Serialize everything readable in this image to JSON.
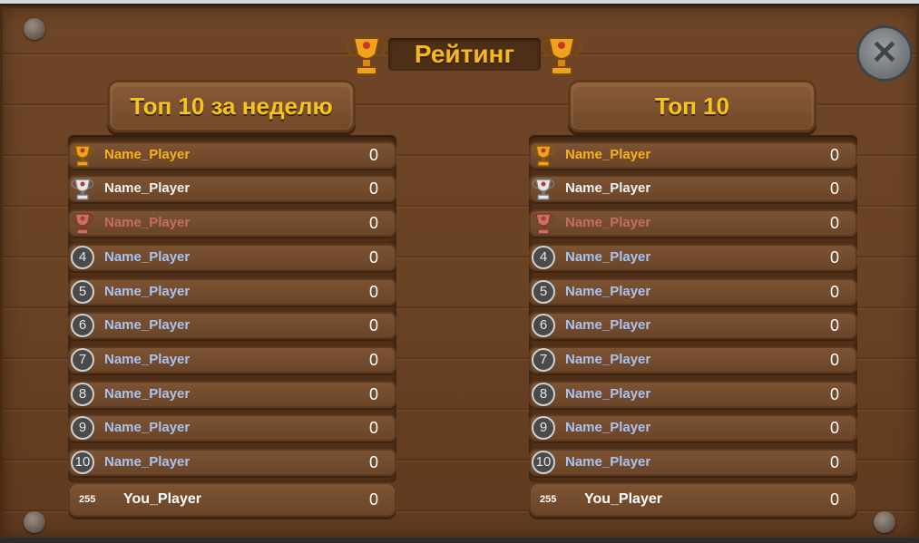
{
  "title": "Рейтинг",
  "close_icon": "close-icon",
  "colors": {
    "gold": "#f7b21a",
    "silver": "#f2f2f2",
    "bronze": "#c46f5c",
    "regular_name": "#a9c3f0"
  },
  "panels": [
    {
      "header": "Топ 10 за неделю",
      "rows": [
        {
          "rank": "1",
          "medal": "gold",
          "name": "Name_Player",
          "score": "0"
        },
        {
          "rank": "2",
          "medal": "silver",
          "name": "Name_Player",
          "score": "0"
        },
        {
          "rank": "3",
          "medal": "bronze",
          "name": "Name_Player",
          "score": "0"
        },
        {
          "rank": "4",
          "medal": "",
          "name": "Name_Player",
          "score": "0"
        },
        {
          "rank": "5",
          "medal": "",
          "name": "Name_Player",
          "score": "0"
        },
        {
          "rank": "6",
          "medal": "",
          "name": "Name_Player",
          "score": "0"
        },
        {
          "rank": "7",
          "medal": "",
          "name": "Name_Player",
          "score": "0"
        },
        {
          "rank": "8",
          "medal": "",
          "name": "Name_Player",
          "score": "0"
        },
        {
          "rank": "9",
          "medal": "",
          "name": "Name_Player",
          "score": "0"
        },
        {
          "rank": "10",
          "medal": "",
          "name": "Name_Player",
          "score": "0"
        }
      ],
      "you": {
        "rank": "255",
        "name": "You_Player",
        "score": "0"
      }
    },
    {
      "header": "Топ 10",
      "rows": [
        {
          "rank": "1",
          "medal": "gold",
          "name": "Name_Player",
          "score": "0"
        },
        {
          "rank": "2",
          "medal": "silver",
          "name": "Name_Player",
          "score": "0"
        },
        {
          "rank": "3",
          "medal": "bronze",
          "name": "Name_Player",
          "score": "0"
        },
        {
          "rank": "4",
          "medal": "",
          "name": "Name_Player",
          "score": "0"
        },
        {
          "rank": "5",
          "medal": "",
          "name": "Name_Player",
          "score": "0"
        },
        {
          "rank": "6",
          "medal": "",
          "name": "Name_Player",
          "score": "0"
        },
        {
          "rank": "7",
          "medal": "",
          "name": "Name_Player",
          "score": "0"
        },
        {
          "rank": "8",
          "medal": "",
          "name": "Name_Player",
          "score": "0"
        },
        {
          "rank": "9",
          "medal": "",
          "name": "Name_Player",
          "score": "0"
        },
        {
          "rank": "10",
          "medal": "",
          "name": "Name_Player",
          "score": "0"
        }
      ],
      "you": {
        "rank": "255",
        "name": "You_Player",
        "score": "0"
      }
    }
  ]
}
